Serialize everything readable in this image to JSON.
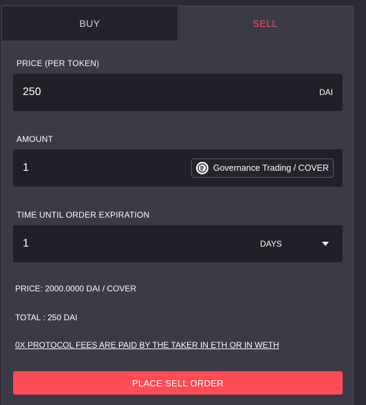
{
  "tabs": [
    {
      "label": "BUY"
    },
    {
      "label": "SELL"
    }
  ],
  "active_tab": "SELL",
  "price": {
    "label": "PRICE (PER TOKEN)",
    "value": "250",
    "unit": "DAI"
  },
  "amount": {
    "label": "AMOUNT",
    "value": "1",
    "token": {
      "name": "Governance Trading / COVER",
      "icon": "cover-token-icon"
    }
  },
  "expiration": {
    "label": "TIME UNTIL ORDER EXPIRATION",
    "value": "1",
    "unit_selected": "DAYS",
    "icon": "chevron-down-icon"
  },
  "summary": {
    "price_text": "PRICE: 2000.0000 DAI / COVER",
    "total_text": "TOTAL : 250 DAI",
    "fees_text": "0X PROTOCOL FEES ARE PAID BY THE TAKER IN ETH OR IN WETH"
  },
  "submit_label": "PLACE SELL ORDER",
  "colors": {
    "accent": "#ff4b55",
    "panel_bg": "#3a3b47",
    "field_bg": "#1f2028",
    "tab_inactive_bg": "#22232b"
  }
}
